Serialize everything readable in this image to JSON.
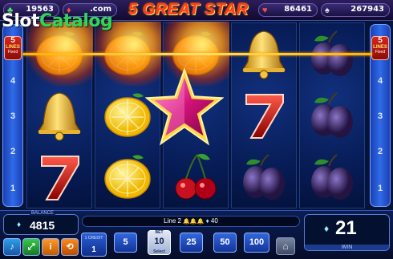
{
  "watermark": {
    "part1": "Slot",
    "part2": "Catalog"
  },
  "header": {
    "title": "5 GREAT STAR",
    "jackpots": [
      {
        "suit": "♣",
        "value": "19563",
        "color": "#59e36a"
      },
      {
        "suit": "♦",
        "value": ".com",
        "color": "#ff4b4b"
      },
      {
        "suit": "♥",
        "value": "86461",
        "color": "#ff4b4b"
      },
      {
        "suit": "♠",
        "value": "267943",
        "color": "#e6e6e6"
      }
    ]
  },
  "side_panel": {
    "lines_count": "5",
    "lines_word": "LINES",
    "fixed_word": "Fixed",
    "line_numbers": [
      "4",
      "3",
      "2",
      "1"
    ]
  },
  "reels": [
    [
      "lemon-burning",
      "bell",
      "seven"
    ],
    [
      "lemon-burning",
      "lemon",
      "lemon"
    ],
    [
      "lemon-burning",
      "star",
      "cherries"
    ],
    [
      "bell",
      "seven",
      "plum"
    ],
    [
      "plum",
      "plum",
      "plum"
    ]
  ],
  "bottom": {
    "balance_label": "BALANCE",
    "balance_value": "4815",
    "info_bar": {
      "line_text": "Line 2",
      "icons": "🔔🔔🔔",
      "win_prefix": "♦",
      "win_value": "40"
    },
    "win_value": "21",
    "win_label": "WIN",
    "credit_label": "1 CREDIT",
    "credit_value": "1",
    "bet_label": "BET",
    "select_label": "Select",
    "bets": [
      "5",
      "10",
      "25",
      "50",
      "100"
    ],
    "selected_bet": "10"
  },
  "colors": {
    "accent": "#ffb300",
    "panel": "#2f6be8",
    "win_star": "#e0208a"
  }
}
